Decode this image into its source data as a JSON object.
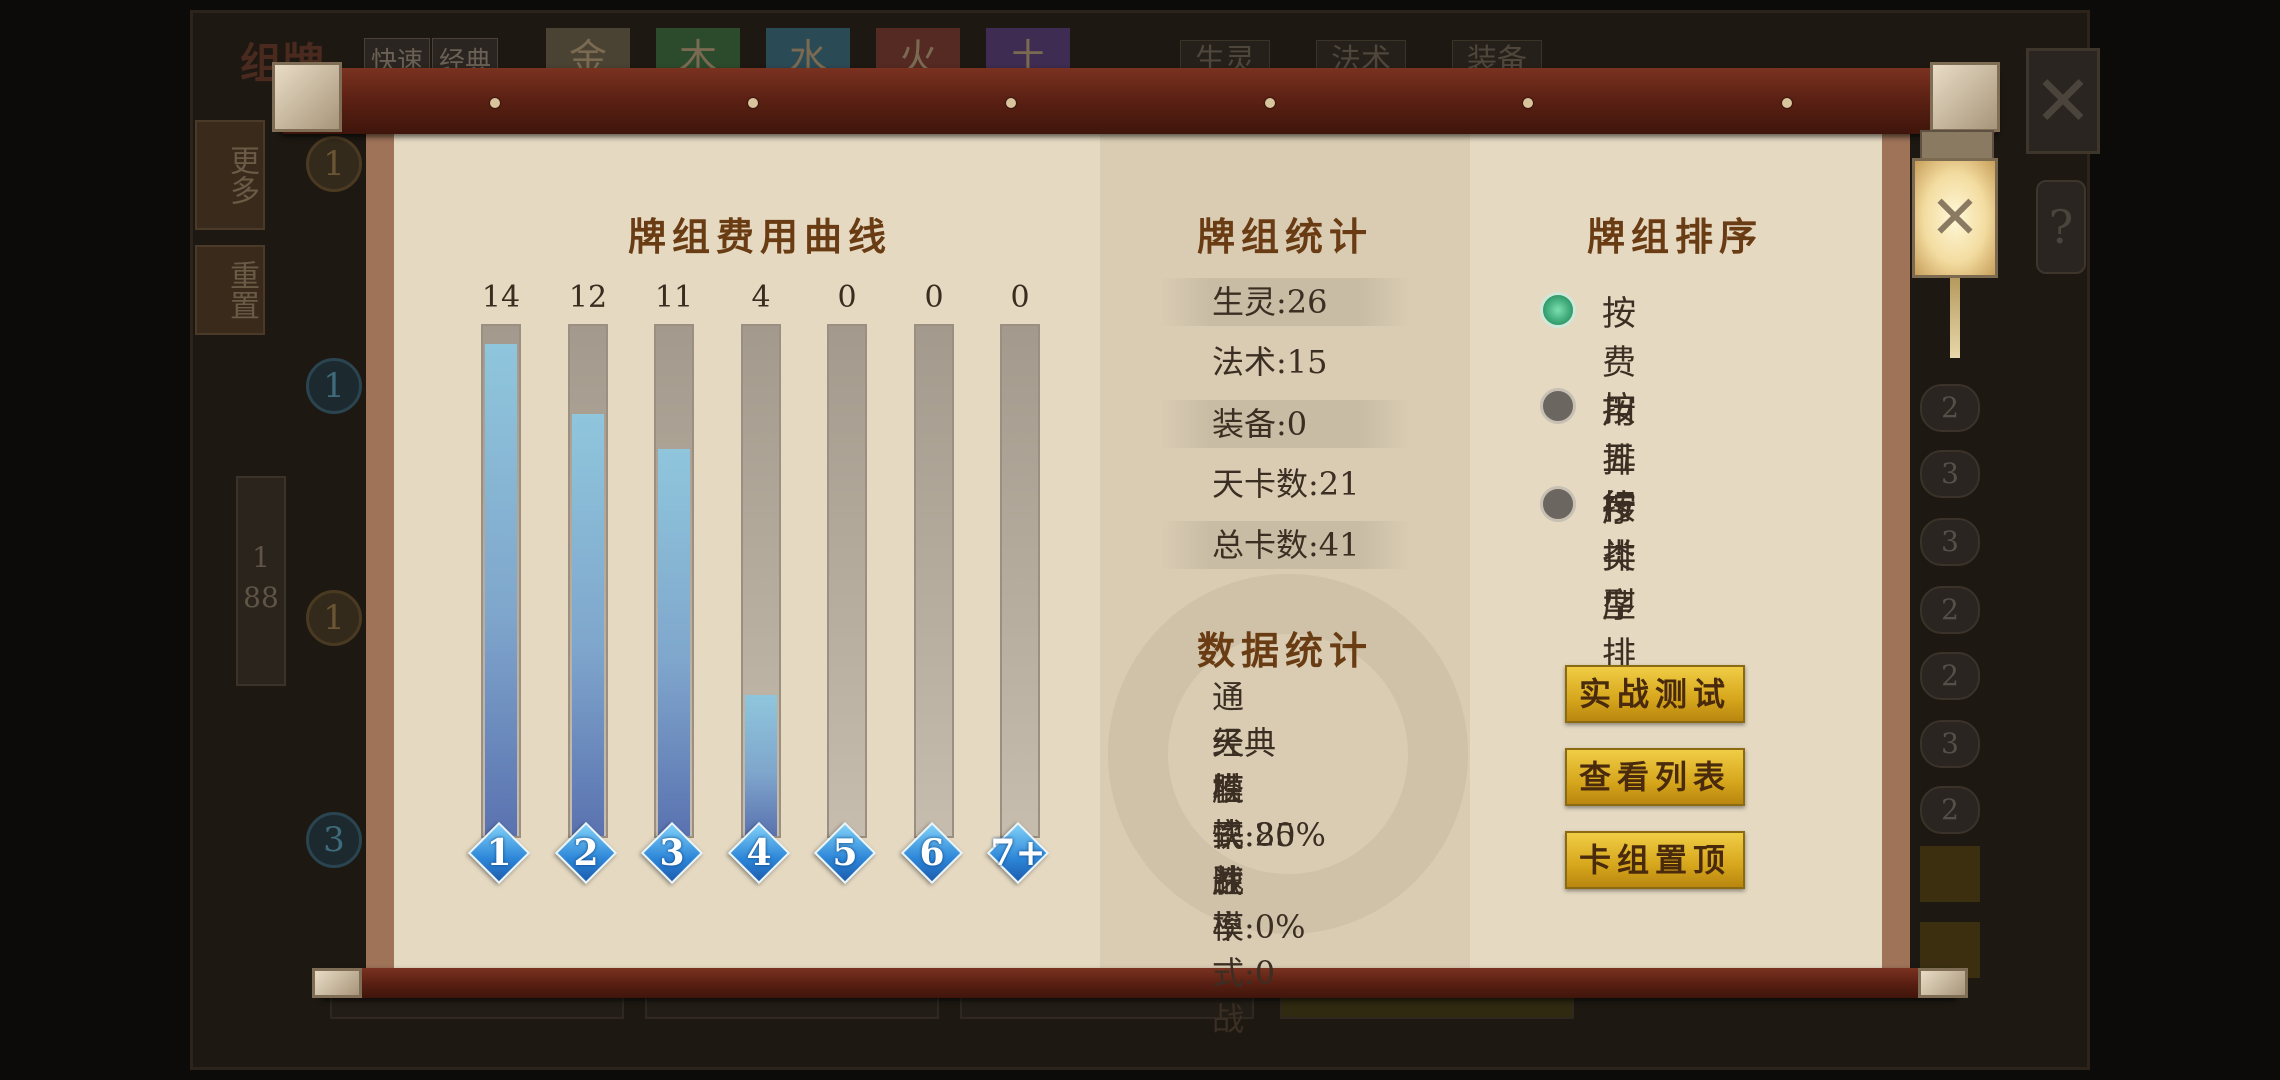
{
  "background": {
    "title": "组牌",
    "mode_quick": "快速",
    "mode_classic": "经典",
    "element_tabs": [
      {
        "label": "金",
        "color": "#4a4232"
      },
      {
        "label": "木",
        "color": "#2c4a2c"
      },
      {
        "label": "水",
        "color": "#2a4a55"
      },
      {
        "label": "火",
        "color": "#552a22"
      },
      {
        "label": "土",
        "color": "#3e2c52"
      }
    ],
    "filters": [
      "生灵",
      "法术",
      "装备"
    ],
    "side_more": "更多",
    "side_reset": "重置",
    "page_current": "1",
    "page_total": "88",
    "list_costs": [
      "1",
      "1",
      "1",
      "3"
    ],
    "right_numbers": [
      "2",
      "3",
      "3",
      "2",
      "2",
      "3",
      "2"
    ]
  },
  "cost_curve": {
    "title": "牌组费用曲线"
  },
  "chart_data": {
    "type": "bar",
    "title": "牌组费用曲线",
    "categories": [
      "1",
      "2",
      "3",
      "4",
      "5",
      "6",
      "7+"
    ],
    "values": [
      14,
      12,
      11,
      4,
      0,
      0,
      0
    ],
    "ylim": [
      0,
      14.5
    ],
    "fill_color": "#7fb0d6",
    "track_color": "#b0a798"
  },
  "deck_stats": {
    "title": "牌组统计",
    "rows": [
      "生灵:26",
      "法术:15",
      "装备:0",
      "天卡数:21",
      "总卡数:41"
    ]
  },
  "data_stats": {
    "title": "数据统计",
    "lines": [
      "通天塔",
      "经典模式:20战",
      "胜率:85%",
      "快速模式:0战",
      "胜率:0%"
    ]
  },
  "deck_sort": {
    "title": "牌组排序",
    "options": [
      {
        "label": "按费用排序",
        "selected": true
      },
      {
        "label": "按五行排序",
        "selected": false
      },
      {
        "label": "按类型排序",
        "selected": false
      }
    ]
  },
  "actions": {
    "battle_test": "实战测试",
    "view_list": "查看列表",
    "pin_deck": "卡组置顶"
  },
  "colors": {
    "paper": "#e1d4bc",
    "rod": "#6a2716",
    "title_text": "#6a3c14",
    "button_gold": "#e2b630",
    "radio_on": "#3fb37f"
  }
}
